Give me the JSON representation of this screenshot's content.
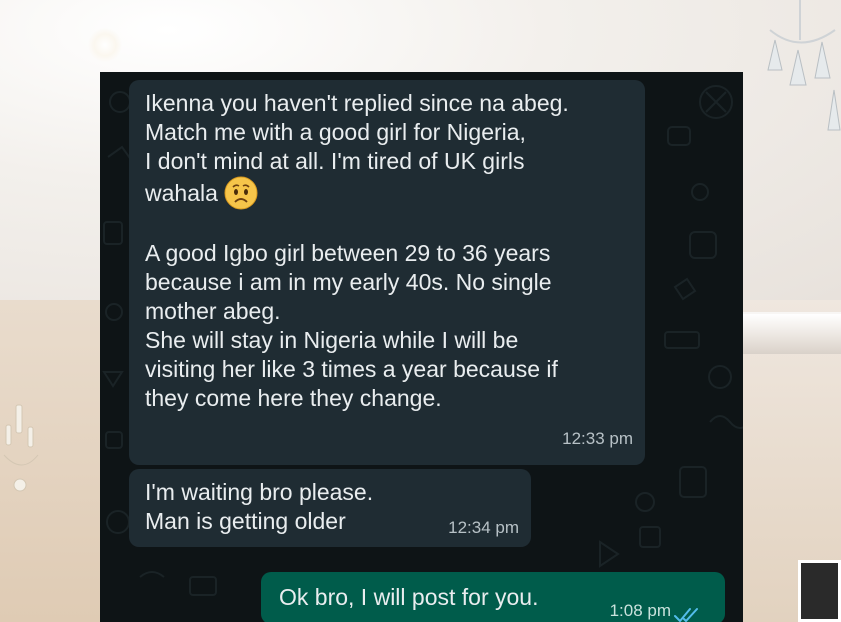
{
  "chat": {
    "messages": [
      {
        "direction": "incoming",
        "text_before_emoji": "Ikenna you haven't replied since na abeg.\nMatch me with a good girl for Nigeria,\nI don't mind at all. I'm tired of UK girls\nwahala ",
        "emoji": "worried-face-icon",
        "text_after_emoji": "\n\nA good Igbo girl between 29 to 36 years\nbecause i am in my early 40s. No single\nmother abeg.\nShe will stay in Nigeria while I will be\nvisiting her like 3 times a year because if\nthey come here they change.",
        "time": "12:33 pm"
      },
      {
        "direction": "incoming",
        "text": "I'm waiting bro please.\nMan is getting older",
        "time": "12:34 pm"
      },
      {
        "direction": "outgoing",
        "text": "Ok bro, I will post for you.",
        "time": "1:08 pm",
        "status_icon": "double-check-read-icon"
      }
    ]
  },
  "colors": {
    "chat_background": "#0e1416",
    "incoming_bubble": "#1f2c33",
    "outgoing_bubble": "#005c4b",
    "text": "#e9edef",
    "read_ticks": "#53bdeb"
  }
}
